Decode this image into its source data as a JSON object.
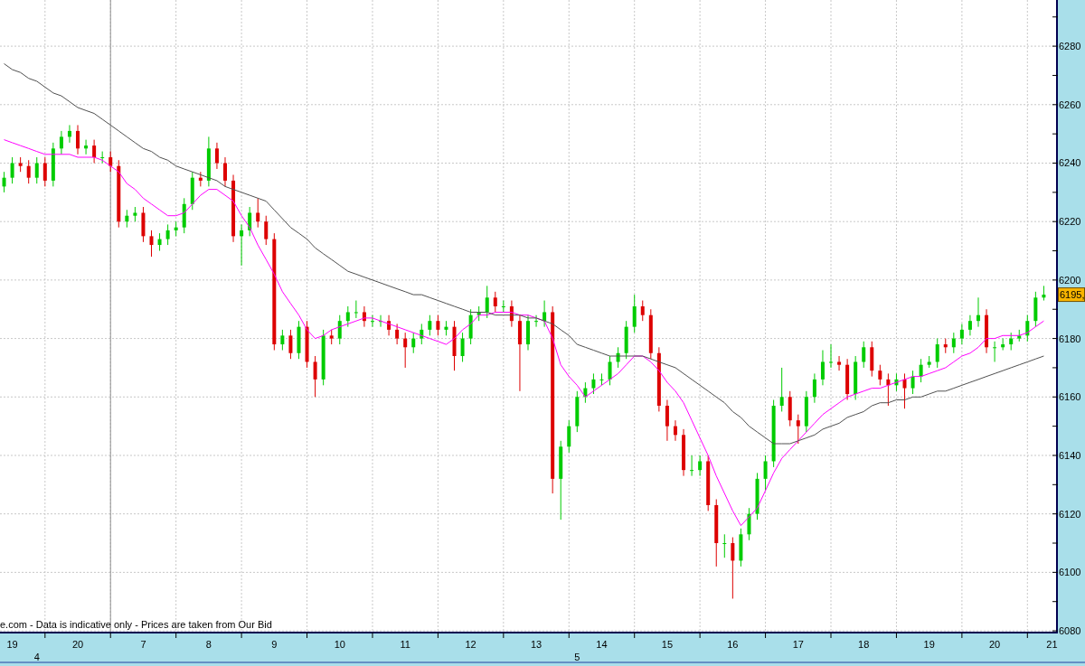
{
  "chart_data": {
    "type": "candlestick",
    "categories": [
      null,
      "19",
      null,
      null,
      null,
      null,
      null,
      null,
      null,
      "20",
      null,
      null,
      null,
      null,
      null,
      null,
      null,
      "7",
      null,
      null,
      null,
      null,
      null,
      null,
      null,
      "8",
      null,
      null,
      null,
      null,
      null,
      null,
      null,
      "9",
      null,
      null,
      null,
      null,
      null,
      null,
      null,
      "10",
      null,
      null,
      null,
      null,
      null,
      null,
      null,
      "11",
      null,
      null,
      null,
      null,
      null,
      null,
      null,
      "12",
      null,
      null,
      null,
      null,
      null,
      null,
      null,
      "13",
      null,
      null,
      null,
      null,
      null,
      null,
      null,
      "14",
      null,
      null,
      null,
      null,
      null,
      null,
      null,
      "15",
      null,
      null,
      null,
      null,
      null,
      null,
      null,
      "16",
      null,
      null,
      null,
      null,
      null,
      null,
      null,
      "17",
      null,
      null,
      null,
      null,
      null,
      null,
      null,
      "18",
      null,
      null,
      null,
      null,
      null,
      null,
      null,
      "19",
      null,
      null,
      null,
      null,
      null,
      null,
      null,
      "20",
      null,
      null,
      null,
      null,
      null,
      null,
      "21"
    ],
    "ohlc": [
      [
        6232,
        6237,
        6230,
        6235
      ],
      [
        6235,
        6242,
        6233,
        6240
      ],
      [
        6240,
        6242,
        6237,
        6239
      ],
      [
        6239,
        6241,
        6233,
        6235
      ],
      [
        6235,
        6242,
        6233,
        6240
      ],
      [
        6240,
        6242,
        6232,
        6234
      ],
      [
        6234,
        6247,
        6232,
        6245
      ],
      [
        6245,
        6251,
        6243,
        6249
      ],
      [
        6249,
        6253,
        6247,
        6251
      ],
      [
        6251,
        6253,
        6243,
        6245
      ],
      [
        6245,
        6248,
        6243,
        6246
      ],
      [
        6246,
        6248,
        6240,
        6242
      ],
      [
        6242,
        6244,
        6240,
        6242
      ],
      [
        6242,
        6244,
        6237,
        6239
      ],
      [
        6239,
        6241,
        6218,
        6220
      ],
      [
        6220,
        6224,
        6218,
        6222
      ],
      [
        6222,
        6225,
        6220,
        6223
      ],
      [
        6223,
        6225,
        6213,
        6215
      ],
      [
        6215,
        6217,
        6208,
        6212
      ],
      [
        6212,
        6216,
        6210,
        6214
      ],
      [
        6214,
        6219,
        6212,
        6217
      ],
      [
        6217,
        6220,
        6215,
        6218
      ],
      [
        6218,
        6228,
        6216,
        6226
      ],
      [
        6226,
        6237,
        6224,
        6235
      ],
      [
        6235,
        6237,
        6232,
        6234
      ],
      [
        6234,
        6249,
        6232,
        6245
      ],
      [
        6245,
        6247,
        6238,
        6240
      ],
      [
        6240,
        6242,
        6232,
        6234
      ],
      [
        6234,
        6236,
        6213,
        6215
      ],
      [
        6215,
        6219,
        6205,
        6217
      ],
      [
        6217,
        6225,
        6215,
        6223
      ],
      [
        6223,
        6228,
        6218,
        6220
      ],
      [
        6220,
        6222,
        6212,
        6214
      ],
      [
        6214,
        6216,
        6176,
        6178
      ],
      [
        6178,
        6183,
        6176,
        6181
      ],
      [
        6181,
        6183,
        6173,
        6175
      ],
      [
        6175,
        6186,
        6173,
        6184
      ],
      [
        6184,
        6186,
        6170,
        6172
      ],
      [
        6172,
        6174,
        6160,
        6166
      ],
      [
        6166,
        6183,
        6164,
        6181
      ],
      [
        6181,
        6183,
        6178,
        6180
      ],
      [
        6180,
        6188,
        6178,
        6186
      ],
      [
        6186,
        6191,
        6184,
        6189
      ],
      [
        6189,
        6193,
        6187,
        6189
      ],
      [
        6189,
        6191,
        6184,
        6186
      ],
      [
        6186,
        6188,
        6184,
        6186
      ],
      [
        6186,
        6188,
        6184,
        6186
      ],
      [
        6186,
        6188,
        6181,
        6183
      ],
      [
        6183,
        6185,
        6178,
        6180
      ],
      [
        6180,
        6182,
        6170,
        6177
      ],
      [
        6177,
        6182,
        6175,
        6180
      ],
      [
        6180,
        6185,
        6178,
        6183
      ],
      [
        6183,
        6188,
        6181,
        6186
      ],
      [
        6186,
        6188,
        6181,
        6183
      ],
      [
        6183,
        6186,
        6181,
        6184
      ],
      [
        6184,
        6186,
        6169,
        6174
      ],
      [
        6174,
        6182,
        6172,
        6180
      ],
      [
        6180,
        6190,
        6178,
        6188
      ],
      [
        6188,
        6191,
        6186,
        6189
      ],
      [
        6189,
        6198,
        6187,
        6194
      ],
      [
        6194,
        6196,
        6189,
        6191
      ],
      [
        6191,
        6193,
        6189,
        6191
      ],
      [
        6191,
        6193,
        6184,
        6186
      ],
      [
        6186,
        6188,
        6162,
        6178
      ],
      [
        6178,
        6188,
        6176,
        6186
      ],
      [
        6186,
        6188,
        6184,
        6186
      ],
      [
        6186,
        6193,
        6184,
        6189
      ],
      [
        6189,
        6191,
        6127,
        6132
      ],
      [
        6132,
        6145,
        6118,
        6143
      ],
      [
        6143,
        6152,
        6141,
        6150
      ],
      [
        6150,
        6162,
        6148,
        6160
      ],
      [
        6160,
        6165,
        6158,
        6163
      ],
      [
        6163,
        6168,
        6161,
        6166
      ],
      [
        6166,
        6168,
        6164,
        6166
      ],
      [
        6166,
        6174,
        6164,
        6172
      ],
      [
        6172,
        6177,
        6170,
        6175
      ],
      [
        6175,
        6186,
        6173,
        6184
      ],
      [
        6184,
        6195,
        6182,
        6191
      ],
      [
        6191,
        6193,
        6186,
        6188
      ],
      [
        6188,
        6190,
        6173,
        6175
      ],
      [
        6175,
        6177,
        6155,
        6157
      ],
      [
        6157,
        6159,
        6145,
        6150
      ],
      [
        6150,
        6152,
        6145,
        6147
      ],
      [
        6147,
        6149,
        6133,
        6135
      ],
      [
        6135,
        6140,
        6133,
        6135
      ],
      [
        6135,
        6140,
        6133,
        6138
      ],
      [
        6138,
        6140,
        6121,
        6123
      ],
      [
        6123,
        6125,
        6102,
        6110
      ],
      [
        6110,
        6113,
        6105,
        6110
      ],
      [
        6110,
        6112,
        6091,
        6104
      ],
      [
        6104,
        6115,
        6102,
        6113
      ],
      [
        6113,
        6122,
        6111,
        6120
      ],
      [
        6120,
        6134,
        6118,
        6132
      ],
      [
        6132,
        6140,
        6128,
        6138
      ],
      [
        6138,
        6159,
        6136,
        6157
      ],
      [
        6157,
        6170,
        6155,
        6160
      ],
      [
        6160,
        6162,
        6150,
        6152
      ],
      [
        6152,
        6154,
        6144,
        6150
      ],
      [
        6150,
        6162,
        6148,
        6160
      ],
      [
        6160,
        6168,
        6158,
        6166
      ],
      [
        6166,
        6176,
        6164,
        6172
      ],
      [
        6172,
        6178,
        6170,
        6172
      ],
      [
        6172,
        6174,
        6169,
        6171
      ],
      [
        6171,
        6173,
        6159,
        6161
      ],
      [
        6161,
        6174,
        6159,
        6172
      ],
      [
        6172,
        6179,
        6170,
        6177
      ],
      [
        6177,
        6179,
        6167,
        6169
      ],
      [
        6169,
        6171,
        6164,
        6166
      ],
      [
        6166,
        6168,
        6157,
        6164
      ],
      [
        6164,
        6168,
        6162,
        6166
      ],
      [
        6166,
        6168,
        6156,
        6163
      ],
      [
        6163,
        6169,
        6161,
        6167
      ],
      [
        6167,
        6173,
        6165,
        6171
      ],
      [
        6171,
        6174,
        6170,
        6172
      ],
      [
        6172,
        6180,
        6170,
        6178
      ],
      [
        6178,
        6180,
        6175,
        6177
      ],
      [
        6177,
        6182,
        6175,
        6180
      ],
      [
        6180,
        6185,
        6178,
        6183
      ],
      [
        6183,
        6188,
        6181,
        6186
      ],
      [
        6186,
        6194,
        6184,
        6188
      ],
      [
        6188,
        6190,
        6175,
        6177
      ],
      [
        6177,
        6179,
        6172,
        6177
      ],
      [
        6177,
        6180,
        6176,
        6178
      ],
      [
        6178,
        6182,
        6176,
        6180
      ],
      [
        6180,
        6183,
        6179,
        6181
      ],
      [
        6181,
        6188,
        6179,
        6186
      ],
      [
        6186,
        6196,
        6184,
        6194
      ],
      [
        6194,
        6198,
        6193,
        6195
      ],
      null
    ],
    "series": [
      {
        "type": "line",
        "color": "#ff00ff",
        "values": [
          6248,
          6247,
          6246,
          6245,
          6244,
          6243,
          6243,
          6243,
          6243,
          6242,
          6242,
          6242,
          6241,
          6239,
          6237,
          6233,
          6231,
          6228,
          6226,
          6224,
          6222,
          6222,
          6223,
          6226,
          6229,
          6231,
          6231,
          6229,
          6227,
          6222,
          6218,
          6212,
          6207,
          6202,
          6196,
          6192,
          6188,
          6183,
          6180,
          6181,
          6183,
          6184,
          6185,
          6186,
          6187,
          6187,
          6186,
          6185,
          6184,
          6183,
          6182,
          6181,
          6180,
          6179,
          6178,
          6180,
          6183,
          6185,
          6188,
          6188,
          6189,
          6189,
          6189,
          6188,
          6188,
          6187,
          6186,
          6180,
          6171,
          6167,
          6164,
          6160,
          6162,
          6164,
          6166,
          6168,
          6171,
          6174,
          6174,
          6172,
          6169,
          6165,
          6162,
          6158,
          6152,
          6146,
          6140,
          6133,
          6127,
          6121,
          6116,
          6119,
          6122,
          6128,
          6134,
          6139,
          6142,
          6145,
          6148,
          6151,
          6154,
          6156,
          6158,
          6160,
          6161,
          6162,
          6163,
          6163,
          6164,
          6165,
          6166,
          6167,
          6167,
          6168,
          6169,
          6170,
          6172,
          6174,
          6175,
          6177,
          6180,
          6180,
          6181,
          6181,
          6181,
          6182,
          6184,
          6186,
          null
        ]
      },
      {
        "type": "line",
        "color": "#505050",
        "values": [
          6274,
          6272,
          6271,
          6269,
          6268,
          6266,
          6264,
          6263,
          6261,
          6259,
          6258,
          6257,
          6255,
          6253,
          6251,
          6249,
          6247,
          6245,
          6244,
          6242,
          6241,
          6239,
          6238,
          6237,
          6236,
          6235,
          6234,
          6232,
          6231,
          6230,
          6229,
          6228,
          6227,
          6224,
          6221,
          6218,
          6216,
          6214,
          6211,
          6209,
          6207,
          6205,
          6203,
          6202,
          6201,
          6200,
          6199,
          6198,
          6197,
          6196,
          6195,
          6195,
          6194,
          6193,
          6192,
          6191,
          6190,
          6189,
          6189,
          6189,
          6188,
          6188,
          6188,
          6188,
          6187,
          6187,
          6186,
          6185,
          6183,
          6181,
          6178,
          6177,
          6176,
          6175,
          6174,
          6174,
          6174,
          6174,
          6174,
          6173,
          6172,
          6171,
          6170,
          6168,
          6166,
          6164,
          6162,
          6160,
          6158,
          6155,
          6153,
          6150,
          6148,
          6146,
          6144,
          6144,
          6144,
          6145,
          6146,
          6147,
          6149,
          6150,
          6151,
          6153,
          6154,
          6155,
          6157,
          6158,
          6158,
          6159,
          6159,
          6160,
          6160,
          6161,
          6162,
          6162,
          6163,
          6164,
          6165,
          6166,
          6167,
          6168,
          6169,
          6170,
          6171,
          6172,
          6173,
          6174,
          null
        ]
      }
    ],
    "grid": true,
    "ylim": [
      6079.4,
      6295.8
    ],
    "yticks": [
      6080,
      6100,
      6120,
      6140,
      6160,
      6180,
      6200,
      6220,
      6240,
      6260,
      6280
    ]
  },
  "month_labels": [
    "4",
    "5"
  ],
  "price_tag": "6195,",
  "disclaimer": "e.com - Data is indicative only - Prices are taken from Our Bid"
}
